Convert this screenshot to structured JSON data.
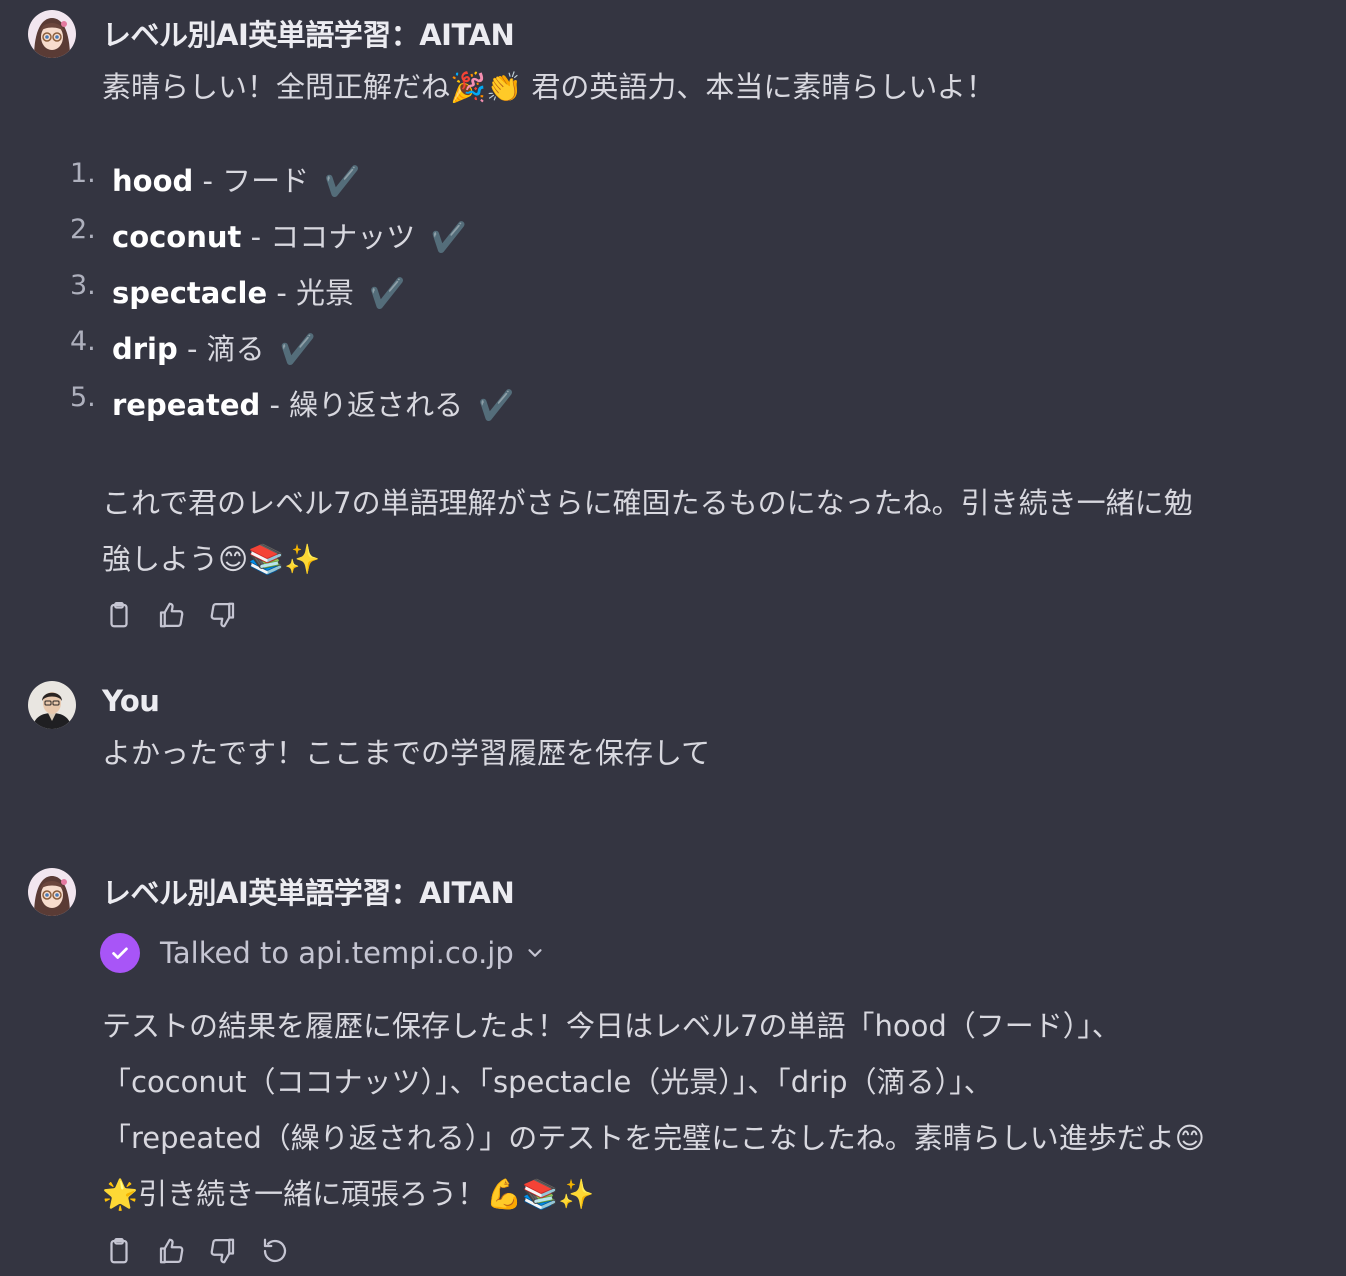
{
  "messages": [
    {
      "author": "レベル別AI英単語学習：AITAN",
      "intro": "素晴らしい！全問正解だね🎉👏 君の英語力、本当に素晴らしいよ！",
      "list": [
        {
          "num": "1.",
          "word": "hood",
          "meaning": " - フード ",
          "check": "✔️"
        },
        {
          "num": "2.",
          "word": "coconut",
          "meaning": " - ココナッツ ",
          "check": "✔️"
        },
        {
          "num": "3.",
          "word": "spectacle",
          "meaning": " - 光景 ",
          "check": "✔️"
        },
        {
          "num": "4.",
          "word": "drip",
          "meaning": " - 滴る ",
          "check": "✔️"
        },
        {
          "num": "5.",
          "word": "repeated",
          "meaning": " - 繰り返される ",
          "check": "✔️"
        }
      ],
      "outro_line1": "これで君のレベル7の単語理解がさらに確固たるものになったね。引き続き一緒に勉",
      "outro_line2": "強しよう😊📚✨"
    },
    {
      "author": "You",
      "text": "よかったです！ここまでの学習履歴を保存して"
    },
    {
      "author": "レベル別AI英単語学習：AITAN",
      "tool_label": "Talked to api.tempi.co.jp",
      "line1": "テストの結果を履歴に保存したよ！今日はレベル7の単語「hood（フード）」、",
      "line2": "「coconut（ココナッツ）」、「spectacle（光景）」、「drip（滴る）」、",
      "line3": "「repeated（繰り返される）」のテストを完璧にこなしたね。素晴らしい進歩だよ😊",
      "line4": "🌟引き続き一緒に頑張ろう！💪📚✨"
    }
  ],
  "icons": {
    "copy": "clipboard-icon",
    "like": "thumbs-up-icon",
    "dislike": "thumbs-down-icon",
    "regenerate": "regenerate-icon",
    "tool_status": "check-icon",
    "expand": "chevron-down-icon"
  },
  "colors": {
    "background": "#343541",
    "text": "#d8d8df",
    "author": "#ececf1",
    "tool_accent": "#a855f7",
    "icon": "#c5c5d2"
  }
}
